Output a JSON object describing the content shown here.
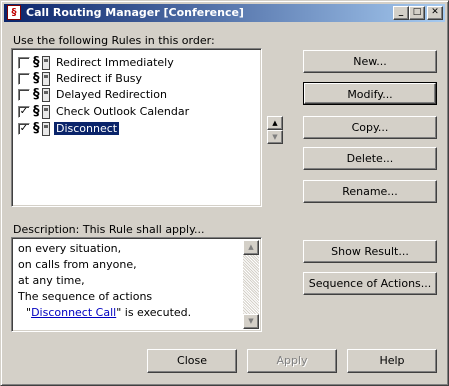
{
  "window": {
    "title": "Call Routing Manager [Conference]",
    "app_icon_glyph": "§",
    "controls": {
      "minimize": "_",
      "maximize": "□",
      "close": "✕"
    }
  },
  "rules": {
    "heading": "Use the following Rules in this order:",
    "items": [
      {
        "label": "Redirect Immediately",
        "checked": false,
        "check_glyph": ""
      },
      {
        "label": "Redirect if Busy",
        "checked": false,
        "check_glyph": ""
      },
      {
        "label": "Delayed Redirection",
        "checked": false,
        "check_glyph": ""
      },
      {
        "label": "Check Outlook Calendar",
        "checked": true,
        "check_glyph": "✓"
      },
      {
        "label": "Disconnect",
        "checked": true,
        "check_glyph": "✓",
        "selected": true
      }
    ],
    "rule_icon_glyph": "§",
    "move_up_glyph": "▲",
    "move_down_glyph": "▼"
  },
  "buttons": {
    "new": "New...",
    "modify": "Modify...",
    "copy": "Copy...",
    "delete": "Delete...",
    "rename": "Rename...",
    "show_result": "Show Result...",
    "sequence_of_actions": "Sequence of Actions...",
    "close": "Close",
    "apply": "Apply",
    "help": "Help"
  },
  "description": {
    "heading": "Description: This Rule shall apply...",
    "line1": "on every situation,",
    "line2": "on calls from anyone,",
    "line3": "at any time,",
    "line4": "The sequence of actions",
    "line5_prefix": "\"",
    "line5_link": "Disconnect Call",
    "line5_suffix": "\" is executed.",
    "scroll_up_glyph": "▲",
    "scroll_down_glyph": "▼"
  }
}
